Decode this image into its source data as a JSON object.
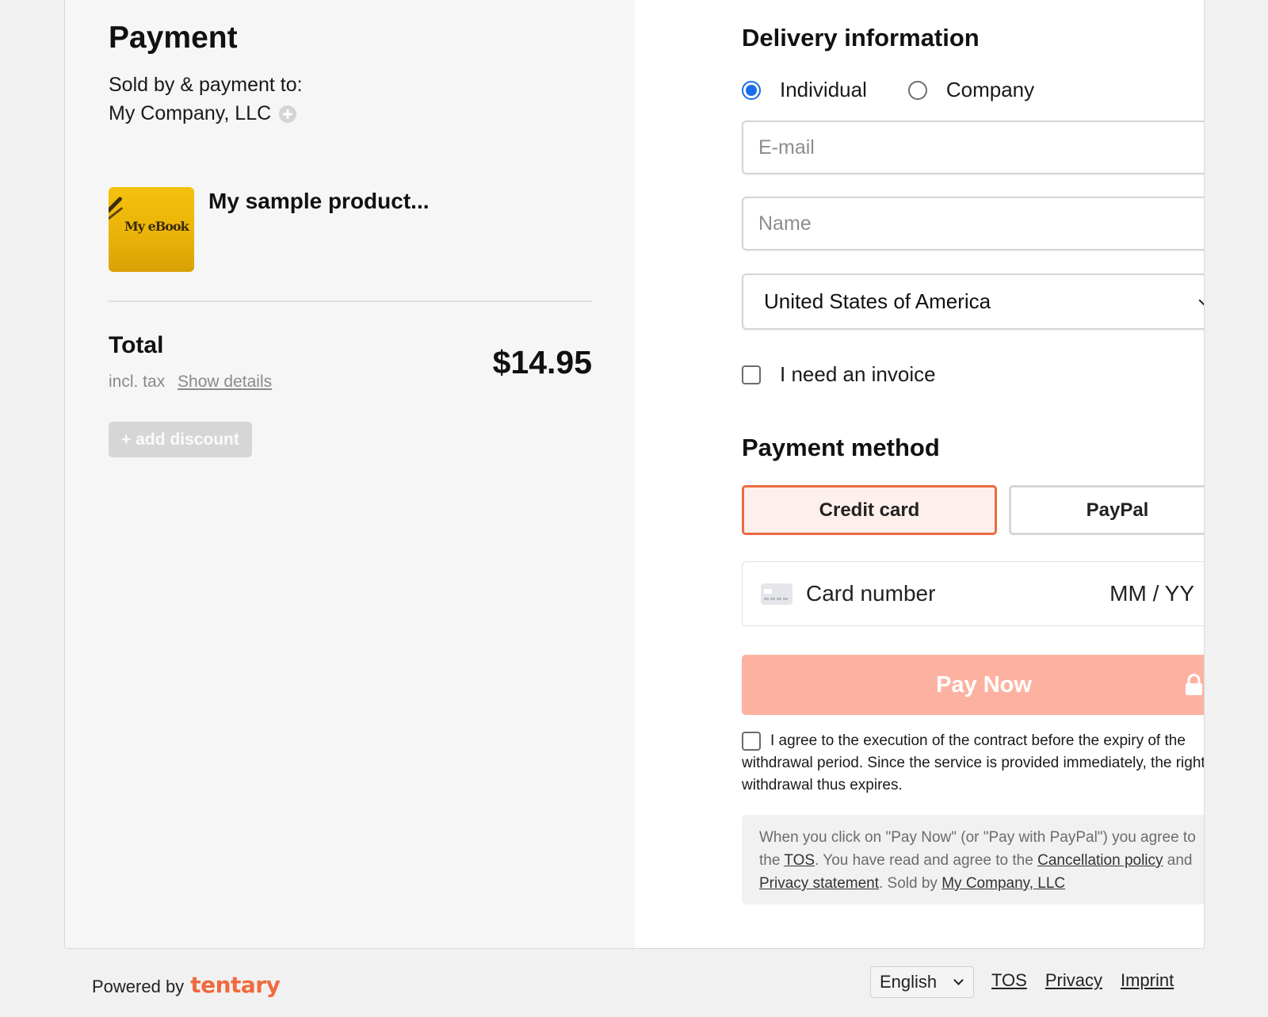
{
  "order": {
    "title": "Payment",
    "sold_by_label": "Sold by & payment to:",
    "seller": "My Company, LLC",
    "product": {
      "thumbnail_text": "My eBook",
      "name": "My sample product..."
    },
    "total_label": "Total",
    "tax_label": "incl. tax",
    "show_details": "Show details",
    "price": "$14.95",
    "discount_button": "+ add discount"
  },
  "delivery": {
    "title": "Delivery information",
    "customer_type": {
      "options": [
        "Individual",
        "Company"
      ],
      "selected": "Individual"
    },
    "email_placeholder": "E-mail",
    "name_placeholder": "Name",
    "country": "United States of America",
    "invoice_label": "I need an invoice"
  },
  "payment": {
    "title": "Payment method",
    "methods": [
      "Credit card",
      "PayPal"
    ],
    "selected_method": "Credit card",
    "card_number_placeholder": "Card number",
    "expiry_placeholder": "MM / YY",
    "pay_button": "Pay Now",
    "agree_text": "I agree to the execution of the contract before the expiry of the withdrawal period. Since the service is provided immediately, the right of withdrawal thus expires.",
    "legal": {
      "part1": "When you click on \"Pay Now\" (or \"Pay with PayPal\") you agree to the ",
      "tos": "TOS",
      "part2": ". You have read and agree to the ",
      "cancellation": "Cancellation policy",
      "part3": " and ",
      "privacy": "Privacy statement",
      "part4": ". Sold by ",
      "seller": "My Company, LLC"
    }
  },
  "footer": {
    "powered_by": "Powered by",
    "brand": "tentary",
    "language": "English",
    "links": [
      "TOS",
      "Privacy",
      "Imprint"
    ]
  },
  "colors": {
    "accent": "#ec6a42",
    "pay_button": "#fdb2a1",
    "radio_selected": "#1a6dea",
    "brand": "#f06a3f"
  }
}
